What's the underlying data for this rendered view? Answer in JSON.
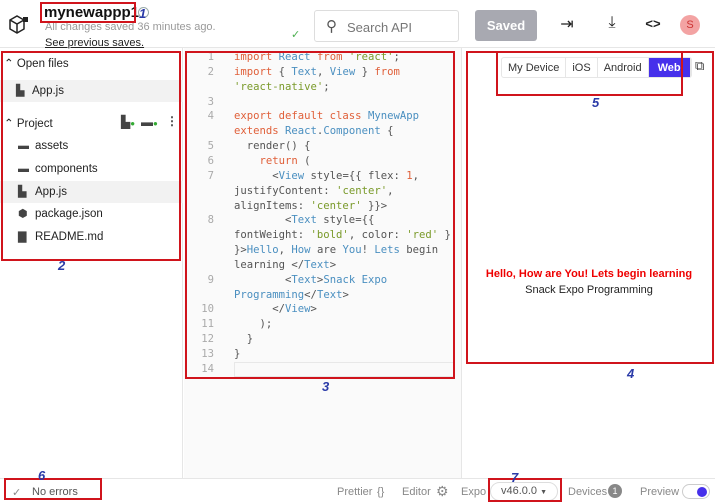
{
  "header": {
    "app_title": "mynewappp1",
    "info_icon": "i",
    "save_status": "All changes saved 36 minutes ago.",
    "previous_saves_link": "See previous saves.",
    "search_placeholder": "Search API",
    "saved_button": "Saved",
    "avatar_initial": "S"
  },
  "sidebar": {
    "open_files_label": "Open files",
    "open_files": [
      {
        "name": "App.js",
        "icon": "js-file-icon"
      }
    ],
    "project_label": "Project",
    "project_items": [
      {
        "name": "assets",
        "icon": "folder-icon"
      },
      {
        "name": "components",
        "icon": "folder-icon"
      },
      {
        "name": "App.js",
        "icon": "js-file-icon",
        "selected": true
      },
      {
        "name": "package.json",
        "icon": "package-icon"
      },
      {
        "name": "README.md",
        "icon": "file-icon"
      }
    ]
  },
  "editor": {
    "lines": [
      {
        "n": "1",
        "t": [
          [
            "k",
            "import "
          ],
          [
            "i",
            "React "
          ],
          [
            "k",
            "from "
          ],
          [
            "s",
            "'react'"
          ],
          [
            "p",
            ";"
          ]
        ]
      },
      {
        "n": "2",
        "t": [
          [
            "k",
            "import "
          ],
          [
            "p",
            "{ "
          ],
          [
            "i",
            "Text"
          ],
          [
            "p",
            ", "
          ],
          [
            "i",
            "View"
          ],
          [
            "p",
            " } "
          ],
          [
            "k",
            "from"
          ]
        ]
      },
      {
        "n": "",
        "t": [
          [
            "s",
            "'react-native'"
          ],
          [
            "p",
            ";"
          ]
        ]
      },
      {
        "n": "3",
        "t": []
      },
      {
        "n": "4",
        "t": [
          [
            "k",
            "export default class "
          ],
          [
            "i",
            "MynewApp"
          ]
        ]
      },
      {
        "n": "",
        "t": [
          [
            "k",
            "extends "
          ],
          [
            "i",
            "React"
          ],
          [
            "p",
            "."
          ],
          [
            "i",
            "Component"
          ],
          [
            "p",
            " {"
          ]
        ]
      },
      {
        "n": "5",
        "t": [
          [
            "p",
            "  render() {"
          ]
        ]
      },
      {
        "n": "6",
        "t": [
          [
            "k",
            "    return "
          ],
          [
            "p",
            "("
          ]
        ]
      },
      {
        "n": "7",
        "t": [
          [
            "p",
            "      <"
          ],
          [
            "i",
            "View"
          ],
          [
            "p",
            " style={{ flex: "
          ],
          [
            "k",
            "1"
          ],
          [
            "p",
            ","
          ]
        ]
      },
      {
        "n": "",
        "t": [
          [
            "p",
            "justifyContent: "
          ],
          [
            "s",
            "'center'"
          ],
          [
            "p",
            ","
          ]
        ]
      },
      {
        "n": "",
        "t": [
          [
            "p",
            "alignItems: "
          ],
          [
            "s",
            "'center'"
          ],
          [
            "p",
            " }}>"
          ]
        ]
      },
      {
        "n": "8",
        "t": [
          [
            "p",
            "        <"
          ],
          [
            "i",
            "Text"
          ],
          [
            "p",
            " style={{"
          ]
        ]
      },
      {
        "n": "",
        "t": [
          [
            "p",
            "fontWeight: "
          ],
          [
            "s",
            "'bold'"
          ],
          [
            "p",
            ", color: "
          ],
          [
            "s",
            "'red'"
          ],
          [
            "p",
            " }"
          ]
        ]
      },
      {
        "n": "",
        "t": [
          [
            "p",
            "}>"
          ],
          [
            "i",
            "Hello"
          ],
          [
            "p",
            ", "
          ],
          [
            "i",
            "How"
          ],
          [
            "p",
            " are "
          ],
          [
            "i",
            "You"
          ],
          [
            "p",
            "! "
          ],
          [
            "i",
            "Lets"
          ],
          [
            "p",
            " begin"
          ]
        ]
      },
      {
        "n": "",
        "t": [
          [
            "p",
            "learning </"
          ],
          [
            "i",
            "Text"
          ],
          [
            "p",
            ">"
          ]
        ]
      },
      {
        "n": "9",
        "t": [
          [
            "p",
            "        <"
          ],
          [
            "i",
            "Text"
          ],
          [
            "p",
            ">"
          ],
          [
            "i",
            "Snack Expo"
          ]
        ]
      },
      {
        "n": "",
        "t": [
          [
            "i",
            "Programming"
          ],
          [
            "p",
            "</"
          ],
          [
            "i",
            "Text"
          ],
          [
            "p",
            ">"
          ]
        ]
      },
      {
        "n": "10",
        "t": [
          [
            "p",
            "      </"
          ],
          [
            "i",
            "View"
          ],
          [
            "p",
            ">"
          ]
        ]
      },
      {
        "n": "11",
        "t": [
          [
            "p",
            "    );"
          ]
        ]
      },
      {
        "n": "12",
        "t": [
          [
            "p",
            "  }"
          ]
        ]
      },
      {
        "n": "13",
        "t": [
          [
            "p",
            "}"
          ]
        ]
      },
      {
        "n": "14",
        "t": []
      }
    ]
  },
  "preview": {
    "device_tabs": [
      "My Device",
      "iOS",
      "Android",
      "Web"
    ],
    "active_tab": "Web",
    "hello_text": "Hello, How are You! Lets begin learning",
    "snack_text": "Snack Expo Programming"
  },
  "footer": {
    "errors": "No errors",
    "prettier": "Prettier",
    "prettier_icon": "{}",
    "editor": "Editor",
    "expo": "Expo",
    "version": "v46.0.0",
    "devices": "Devices",
    "devices_count": "1",
    "preview": "Preview",
    "preview_enabled": true
  },
  "annotations": [
    "1",
    "2",
    "3",
    "4",
    "5",
    "6",
    "7"
  ],
  "colors": {
    "accent": "#4630eb",
    "annotation_box": "#d0141c",
    "annotation_number": "#2b3ba8"
  }
}
